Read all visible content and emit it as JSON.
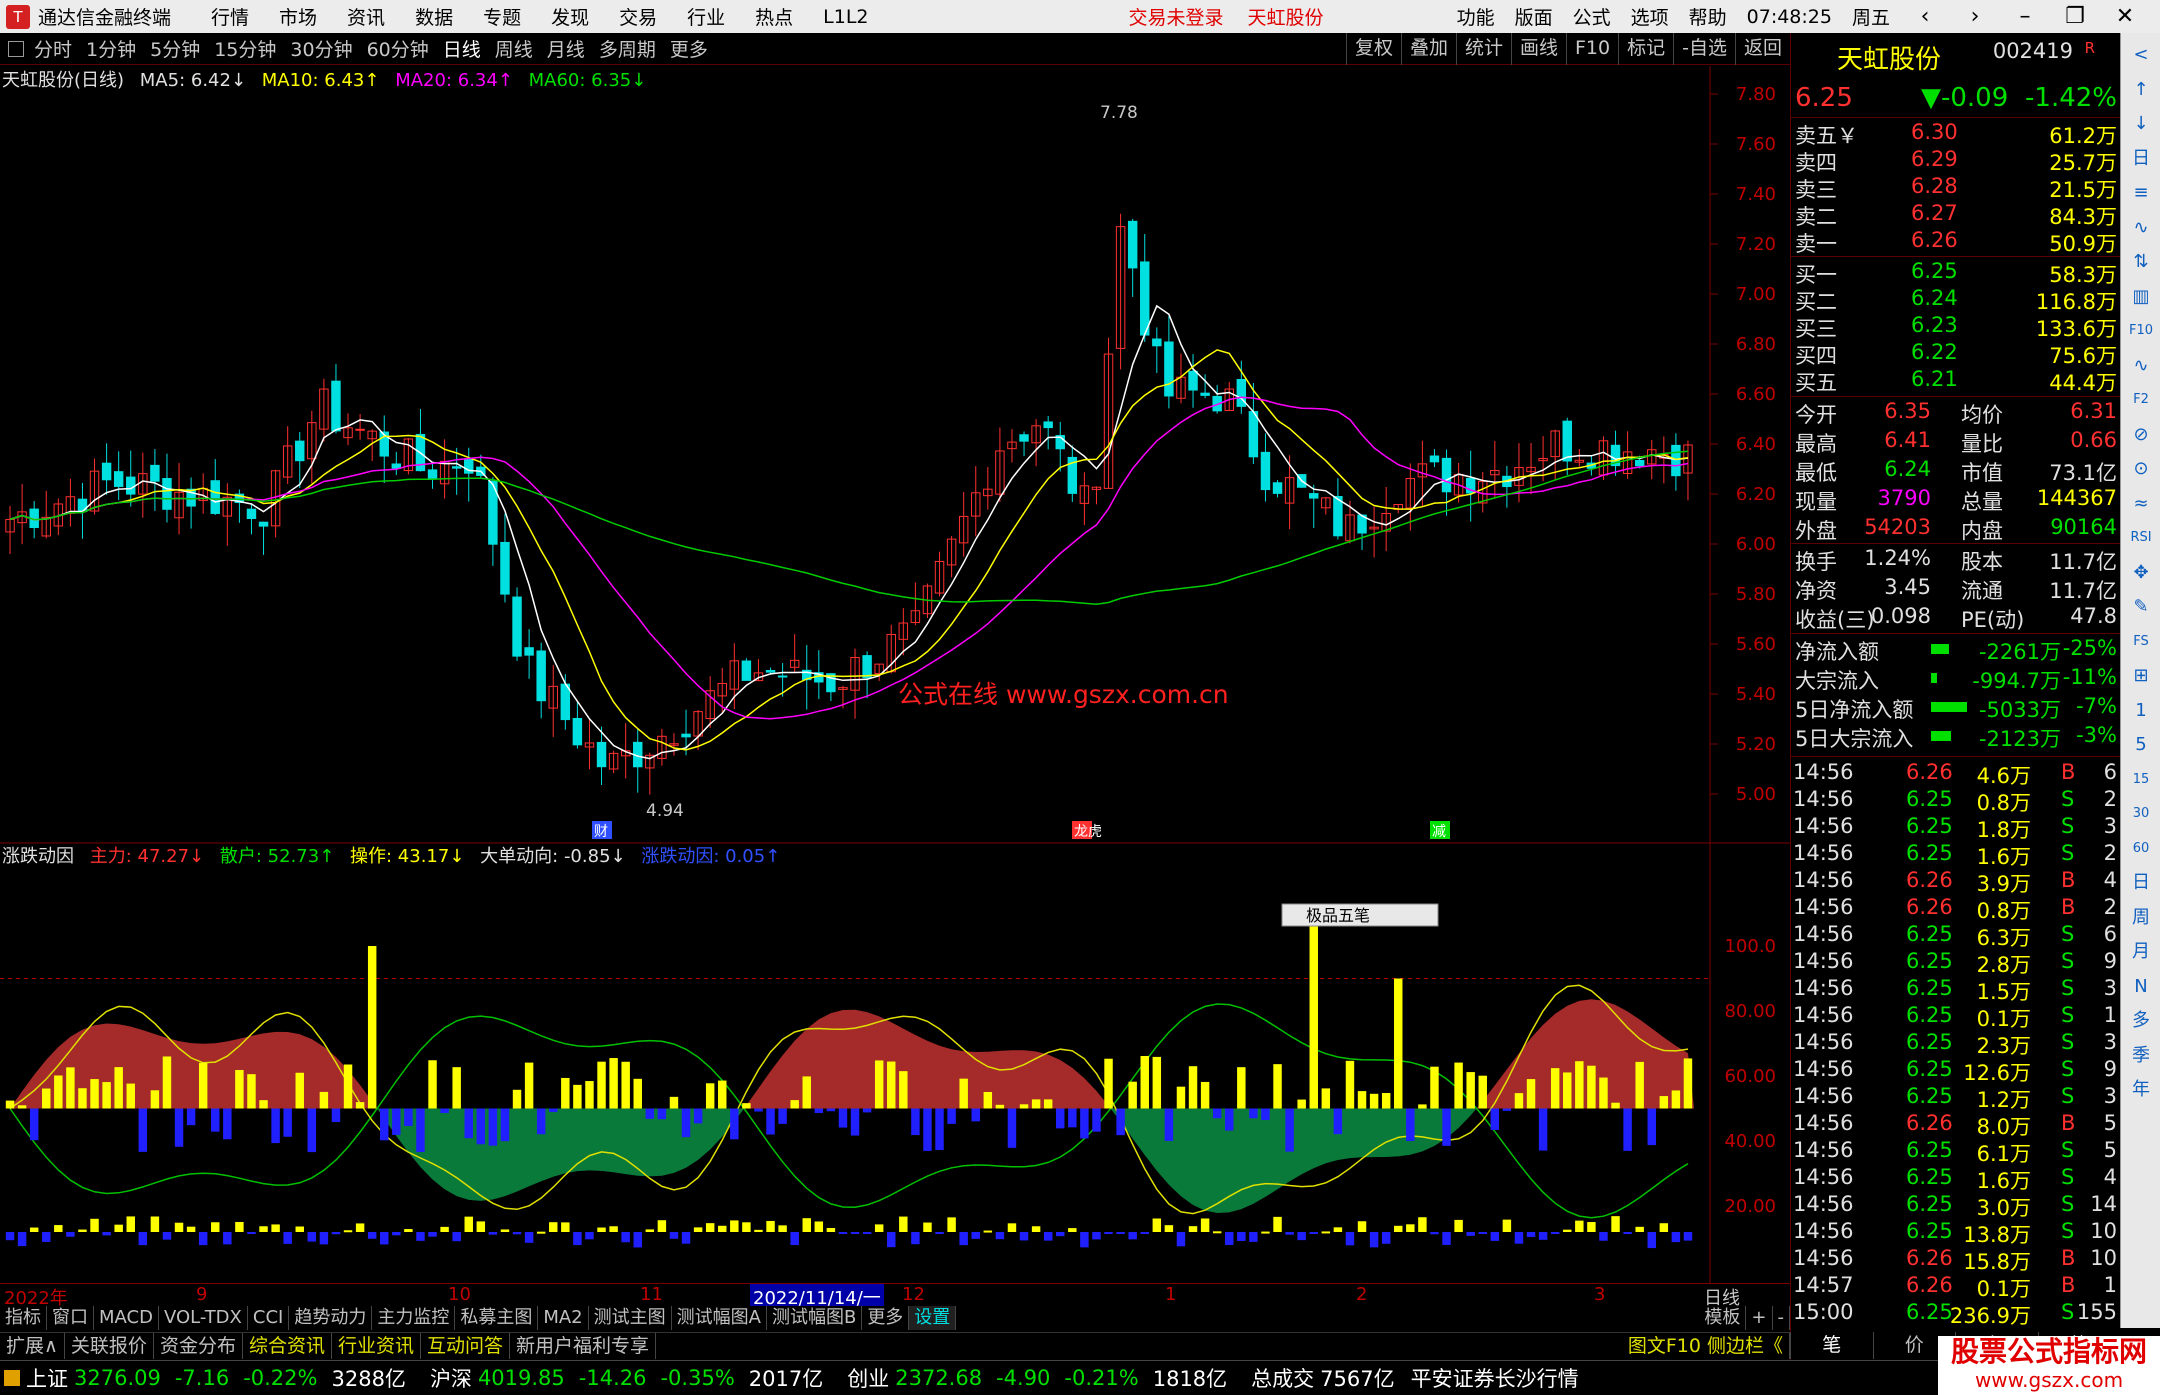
{
  "app": {
    "title": "通达信金融终端",
    "logo_text": "T",
    "menu": [
      "行情",
      "市场",
      "资讯",
      "数据",
      "专题",
      "发现",
      "交易",
      "行业",
      "热点",
      "L1L2"
    ],
    "trade_status": "交易未登录",
    "stock_name": "天虹股份",
    "right_menu": [
      "功能",
      "版面",
      "公式",
      "选项",
      "帮助"
    ],
    "clock": "07:48:25",
    "weekday": "周五"
  },
  "toolbar": {
    "periods": [
      "分时",
      "1分钟",
      "5分钟",
      "15分钟",
      "30分钟",
      "60分钟",
      "日线",
      "周线",
      "月线",
      "多周期",
      "更多"
    ],
    "active": "日线",
    "right": [
      "复权",
      "叠加",
      "统计",
      "画线",
      "F10",
      "标记",
      "-自选",
      "返回"
    ]
  },
  "legend1": {
    "title": "天虹股份(日线)",
    "ma5": "MA5: 6.42↓",
    "ma10": "MA10: 6.43↑",
    "ma20": "MA20: 6.34↑",
    "ma60": "MA60: 6.35↓"
  },
  "legend2": {
    "name": "涨跌动因",
    "zl": "主力: 47.27↓",
    "sh": "散户: 52.73↑",
    "cz": "操作: 43.17↓",
    "dd": "大单动向: -0.85↓",
    "zd": "涨跌动因: 0.05↑"
  },
  "annotations": {
    "high": "7.78",
    "low": "4.94",
    "watermark": "公式在线 www.gszx.com.cn",
    "ev1": "财",
    "ev2": "龙虎",
    "ev3": "减",
    "popup": "极品五笔"
  },
  "price_axis": [
    "7.80",
    "7.60",
    "7.40",
    "7.20",
    "7.00",
    "6.80",
    "6.60",
    "6.40",
    "6.20",
    "6.00",
    "5.80",
    "5.60",
    "5.40",
    "5.20",
    "5.00"
  ],
  "ind_axis": [
    "100.0",
    "80.00",
    "60.00",
    "40.00",
    "20.00"
  ],
  "time_axis": [
    "2022年",
    "9",
    "10",
    "11",
    "2022/11/14/一",
    "12",
    "1",
    "2",
    "3"
  ],
  "period_label": "日线",
  "bottom_tabs": [
    "指标",
    "窗口",
    "MACD",
    "VOL-TDX",
    "CCI",
    "趋势动力",
    "主力监控",
    "私募主图",
    "MA2",
    "测试主图",
    "测试幅图A",
    "测试幅图B",
    "更多",
    "设置"
  ],
  "bottom_right": [
    "模板",
    "+",
    "-"
  ],
  "link_bar": [
    "扩展∧",
    "关联报价",
    "资金分布",
    "综合资讯",
    "行业资讯",
    "互动问答",
    "新用户福利专享"
  ],
  "link_right": "图文F10  侧边栏《",
  "index_bar": [
    {
      "name": "上证",
      "value": "3276.09",
      "chg": "-7.16",
      "pct": "-0.22%",
      "amt": "3288亿"
    },
    {
      "name": "沪深",
      "value": "4019.85",
      "chg": "-14.26",
      "pct": "-0.35%",
      "amt": "2017亿"
    },
    {
      "name": "创业",
      "value": "2372.68",
      "chg": "-4.90",
      "pct": "-0.21%",
      "amt": "1818亿"
    }
  ],
  "index_total": {
    "label": "总成交",
    "value": "7567亿"
  },
  "broker": "平安证券长沙行情",
  "quote": {
    "name": "天虹股份",
    "code": "002419",
    "flag": "R",
    "price": "6.25",
    "chg": "▼-0.09",
    "pct": "-1.42%",
    "asks": [
      {
        "l": "卖五￥",
        "p": "6.30",
        "v": "61.2万"
      },
      {
        "l": "卖四",
        "p": "6.29",
        "v": "25.7万"
      },
      {
        "l": "卖三",
        "p": "6.28",
        "v": "21.5万"
      },
      {
        "l": "卖二",
        "p": "6.27",
        "v": "84.3万"
      },
      {
        "l": "卖一",
        "p": "6.26",
        "v": "50.9万"
      }
    ],
    "bids": [
      {
        "l": "买一",
        "p": "6.25",
        "v": "58.3万"
      },
      {
        "l": "买二",
        "p": "6.24",
        "v": "116.8万"
      },
      {
        "l": "买三",
        "p": "6.23",
        "v": "133.6万"
      },
      {
        "l": "买四",
        "p": "6.22",
        "v": "75.6万"
      },
      {
        "l": "买五",
        "p": "6.21",
        "v": "44.4万"
      }
    ],
    "stats": [
      {
        "a": "今开",
        "b": "6.35",
        "c": "均价",
        "d": "6.31"
      },
      {
        "a": "最高",
        "b": "6.41",
        "c": "量比",
        "d": "0.66"
      },
      {
        "a": "最低",
        "b": "6.24",
        "c": "市值",
        "d": "73.1亿"
      },
      {
        "a": "现量",
        "b": "3790",
        "c": "总量",
        "d": "144367"
      },
      {
        "a": "外盘",
        "b": "54203",
        "c": "内盘",
        "d": "90164"
      }
    ],
    "stats2": [
      {
        "a": "换手",
        "b": "1.24%",
        "c": "股本",
        "d": "11.7亿"
      },
      {
        "a": "净资",
        "b": "3.45",
        "c": "流通",
        "d": "11.7亿"
      },
      {
        "a": "收益(三)",
        "b": "0.098",
        "c": "PE(动)",
        "d": "47.8"
      }
    ],
    "flows": [
      {
        "l": "净流入额",
        "v": "-2261万",
        "p": "-25%"
      },
      {
        "l": "大宗流入",
        "v": "-994.7万",
        "p": "-11%"
      },
      {
        "l": "5日净流入额",
        "v": "-5033万",
        "p": "-7%"
      },
      {
        "l": "5日大宗流入",
        "v": "-2123万",
        "p": "-3%"
      }
    ],
    "ticks": [
      {
        "t": "14:56",
        "p": "6.26",
        "v": "4.6万",
        "s": "B",
        "n": "6"
      },
      {
        "t": "14:56",
        "p": "6.25",
        "v": "0.8万",
        "s": "S",
        "n": "2"
      },
      {
        "t": "14:56",
        "p": "6.25",
        "v": "1.8万",
        "s": "S",
        "n": "3"
      },
      {
        "t": "14:56",
        "p": "6.25",
        "v": "1.6万",
        "s": "S",
        "n": "2"
      },
      {
        "t": "14:56",
        "p": "6.26",
        "v": "3.9万",
        "s": "B",
        "n": "4"
      },
      {
        "t": "14:56",
        "p": "6.26",
        "v": "0.8万",
        "s": "B",
        "n": "2"
      },
      {
        "t": "14:56",
        "p": "6.25",
        "v": "6.3万",
        "s": "S",
        "n": "6"
      },
      {
        "t": "14:56",
        "p": "6.25",
        "v": "2.8万",
        "s": "S",
        "n": "9"
      },
      {
        "t": "14:56",
        "p": "6.25",
        "v": "1.5万",
        "s": "S",
        "n": "3"
      },
      {
        "t": "14:56",
        "p": "6.25",
        "v": "0.1万",
        "s": "S",
        "n": "1"
      },
      {
        "t": "14:56",
        "p": "6.25",
        "v": "2.3万",
        "s": "S",
        "n": "3"
      },
      {
        "t": "14:56",
        "p": "6.25",
        "v": "12.6万",
        "s": "S",
        "n": "9"
      },
      {
        "t": "14:56",
        "p": "6.25",
        "v": "1.2万",
        "s": "S",
        "n": "3"
      },
      {
        "t": "14:56",
        "p": "6.26",
        "v": "8.0万",
        "s": "B",
        "n": "5"
      },
      {
        "t": "14:56",
        "p": "6.25",
        "v": "6.1万",
        "s": "S",
        "n": "5"
      },
      {
        "t": "14:56",
        "p": "6.25",
        "v": "1.6万",
        "s": "S",
        "n": "4"
      },
      {
        "t": "14:56",
        "p": "6.25",
        "v": "3.0万",
        "s": "S",
        "n": "14"
      },
      {
        "t": "14:56",
        "p": "6.25",
        "v": "13.8万",
        "s": "S",
        "n": "10"
      },
      {
        "t": "14:56",
        "p": "6.26",
        "v": "15.8万",
        "s": "B",
        "n": "10"
      },
      {
        "t": "14:57",
        "p": "6.26",
        "v": "0.1万",
        "s": "B",
        "n": "1"
      },
      {
        "t": "15:00",
        "p": "6.25",
        "v": "236.9万",
        "s": "S",
        "n": "155"
      }
    ]
  },
  "right_tabs": [
    "笔",
    "价",
    "细",
    "势"
  ],
  "watermark": {
    "line1": "股票公式指标网",
    "line2": "www.gszx.com"
  },
  "sidebar_icons": [
    "<",
    "↑",
    "↓",
    "日",
    "≡",
    "∿",
    "⇅",
    "▥",
    "F10",
    "∿",
    "F2",
    "⊘",
    "⊙",
    "≈",
    "RSI",
    "✥",
    "✎",
    "FS",
    "⊞",
    "1",
    "5",
    "15",
    "30",
    "60",
    "日",
    "周",
    "月",
    "N",
    "多",
    "季",
    "年"
  ],
  "colors": {
    "up": "#ff3030",
    "down": "#00e0e0",
    "ma5": "#ffffff",
    "ma10": "#ffff00",
    "ma20": "#ff00ff",
    "ma60": "#00cc00"
  }
}
